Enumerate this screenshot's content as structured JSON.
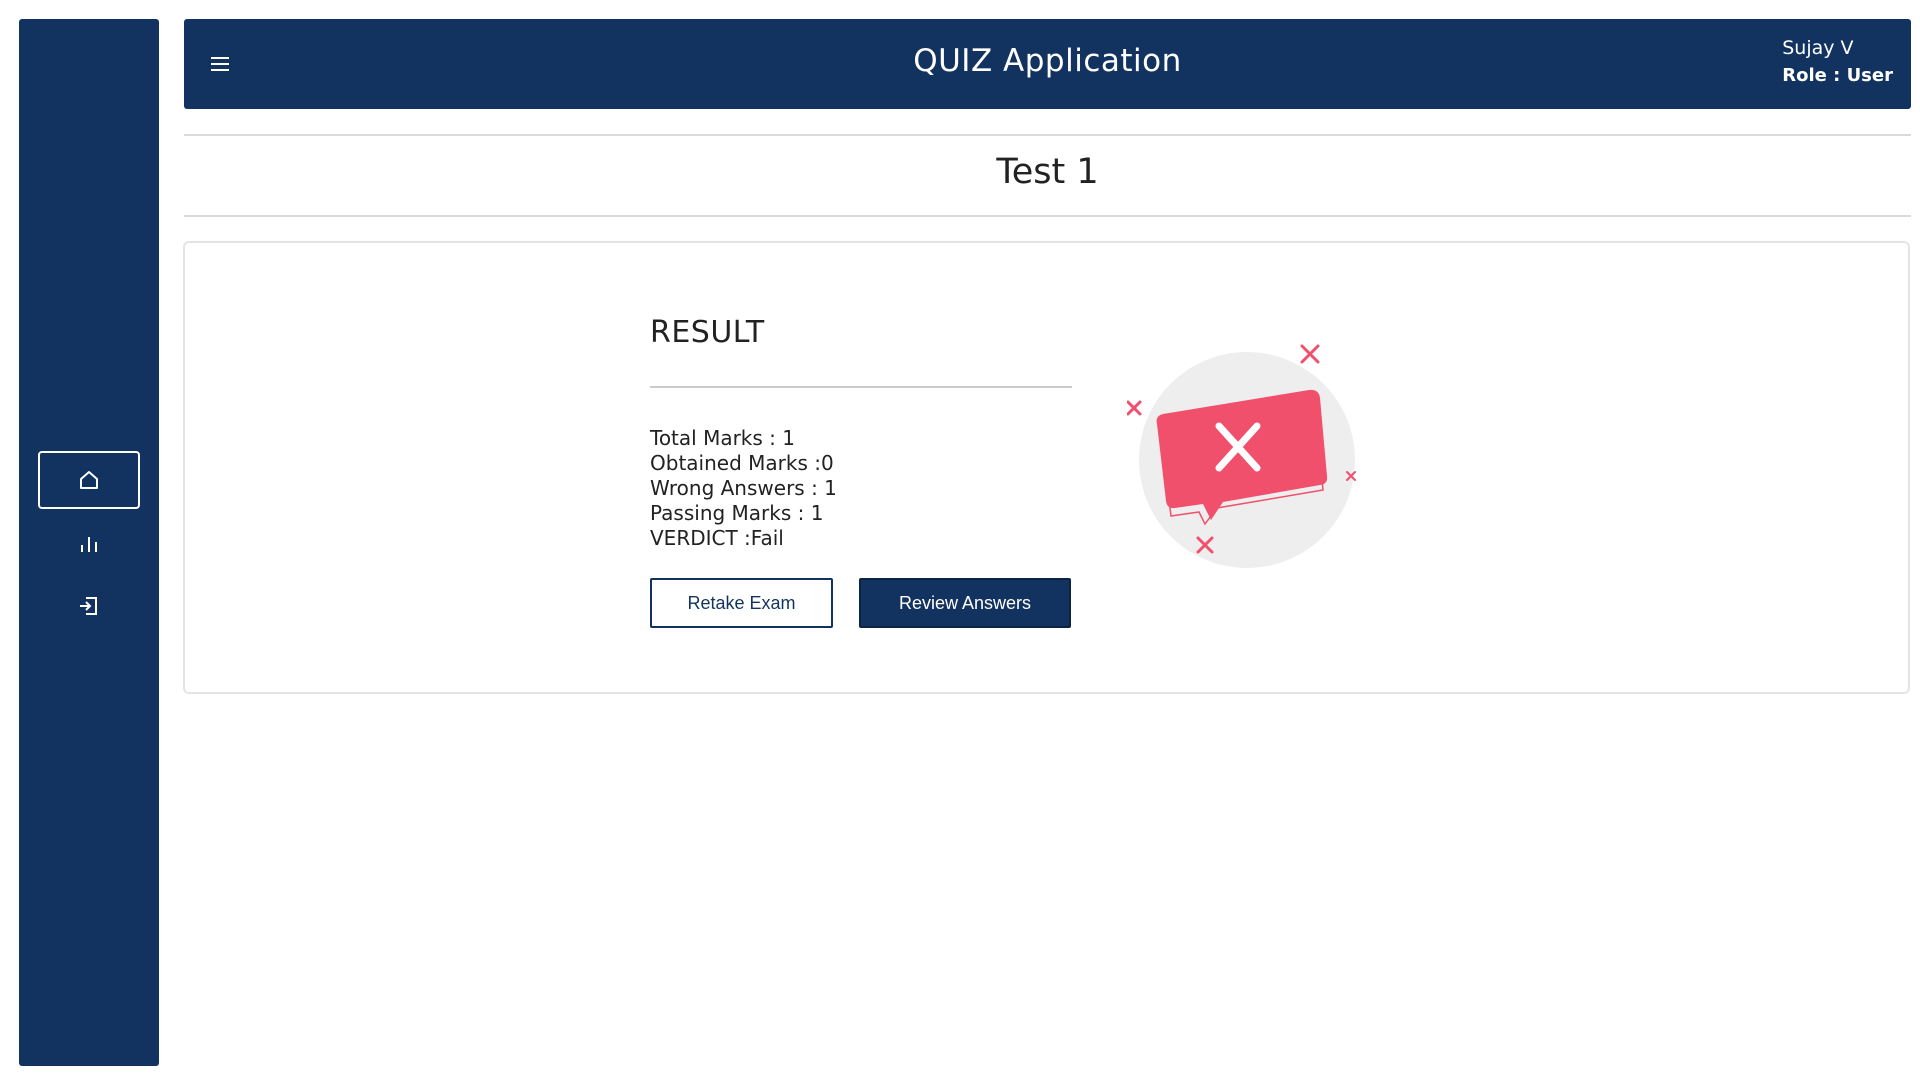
{
  "header": {
    "title": "QUIZ Application",
    "user_name": "Sujay V",
    "user_role": "Role : User"
  },
  "sidebar": {
    "items": [
      {
        "name": "home",
        "icon": "home-icon",
        "active": true
      },
      {
        "name": "stats",
        "icon": "bar-chart-icon",
        "active": false
      },
      {
        "name": "logout",
        "icon": "logout-icon",
        "active": false
      }
    ]
  },
  "page": {
    "test_title": "Test 1"
  },
  "result": {
    "heading": "RESULT",
    "total_marks": "Total Marks : 1",
    "obtained_marks": "Obtained Marks :0",
    "wrong_answers": "Wrong Answers : 1",
    "passing_marks": "Passing Marks : 1",
    "verdict": "VERDICT :Fail",
    "retake_label": "Retake Exam",
    "review_label": "Review Answers",
    "illustration_icon": "fail-x-speech-bubble-icon"
  },
  "colors": {
    "primary": "#12335f",
    "fail_accent": "#f1506d",
    "illustration_bg": "#eeeeee"
  }
}
